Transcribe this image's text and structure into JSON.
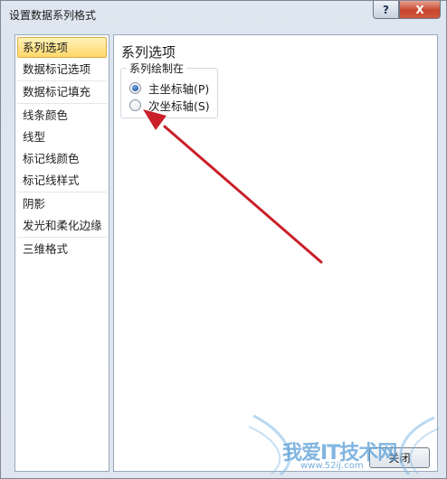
{
  "window": {
    "title": "设置数据系列格式"
  },
  "titlebar": {
    "help_glyph": "?",
    "close_glyph": "X"
  },
  "nav": {
    "items": [
      {
        "label": "系列选项",
        "selected": true
      },
      {
        "label": "数据标记选项",
        "selected": false
      },
      {
        "label": "数据标记填充",
        "selected": false
      },
      {
        "label": "线条颜色",
        "selected": false
      },
      {
        "label": "线型",
        "selected": false
      },
      {
        "label": "标记线颜色",
        "selected": false
      },
      {
        "label": "标记线样式",
        "selected": false
      },
      {
        "label": "阴影",
        "selected": false
      },
      {
        "label": "发光和柔化边缘",
        "selected": false
      },
      {
        "label": "三维格式",
        "selected": false
      }
    ]
  },
  "panel": {
    "title": "系列选项",
    "group_label": "系列绘制在",
    "options": [
      {
        "label": "主坐标轴(P)",
        "checked": true
      },
      {
        "label": "次坐标轴(S)",
        "checked": false
      }
    ]
  },
  "footer": {
    "close_label": "关闭"
  },
  "watermark": {
    "text": "我爱IT技术网",
    "url": "www.52ij.com"
  },
  "colors": {
    "selected_nav": "#ffd86a",
    "arrow": "#c9202a",
    "radio_checked": "#1c4d94"
  }
}
